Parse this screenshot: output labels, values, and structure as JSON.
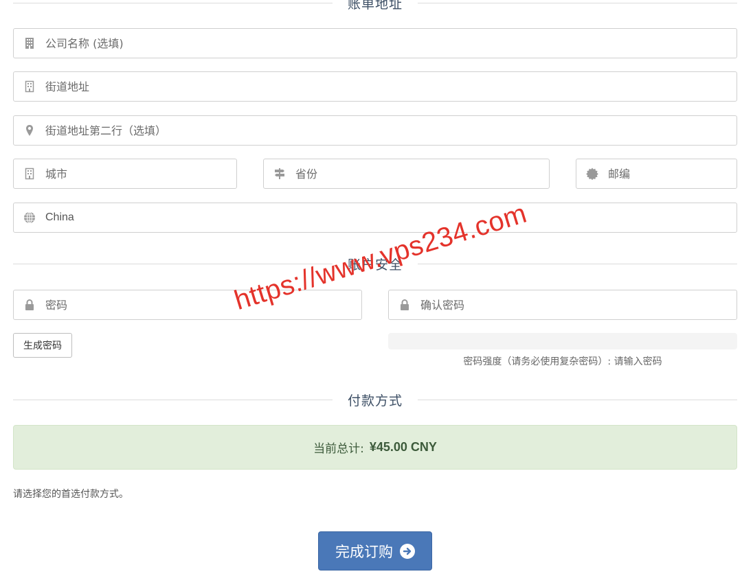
{
  "sections": {
    "billing": "账单地址",
    "security": "账户安全",
    "payment": "付款方式"
  },
  "fields": {
    "company": {
      "placeholder": "公司名称 (选填)",
      "icon": "building-icon"
    },
    "street": {
      "placeholder": "街道地址",
      "icon": "building-outline-icon"
    },
    "street2": {
      "placeholder": "街道地址第二行（选填）",
      "icon": "map-marker-icon"
    },
    "city": {
      "placeholder": "城市",
      "icon": "building-outline-icon"
    },
    "state": {
      "placeholder": "省份",
      "icon": "signpost-icon"
    },
    "postcode": {
      "placeholder": "邮编",
      "icon": "certificate-icon"
    },
    "country": {
      "value": "China",
      "icon": "globe-icon"
    },
    "password": {
      "placeholder": "密码",
      "icon": "lock-icon"
    },
    "password_confirm": {
      "placeholder": "确认密码",
      "icon": "lock-icon"
    }
  },
  "security": {
    "generate_label": "生成密码",
    "strength_text": "密码强度（请务必使用复杂密码）: 请输入密码",
    "strength_level": 0
  },
  "payment": {
    "total_label": "当前总计:",
    "total_amount": "¥45.00 CNY",
    "note": "请选择您的首选付款方式。"
  },
  "complete_label": "完成订购",
  "watermark": "https://www.vps234.com",
  "colors": {
    "accent": "#4a78b8",
    "success_bg": "#e2eedb",
    "watermark": "#e4332b"
  }
}
